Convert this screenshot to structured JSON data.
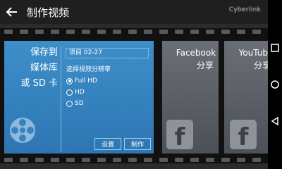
{
  "header": {
    "title": "制作视频",
    "account": "Cyberlink"
  },
  "save_card": {
    "title": "保存到\n媒体库\n或 SD 卡",
    "project_name": "项目 02-27",
    "resolution_label": "选择视频分辨率",
    "options": [
      {
        "label": "Full HD",
        "selected": true
      },
      {
        "label": "HD",
        "selected": false
      },
      {
        "label": "SD",
        "selected": false
      }
    ],
    "settings_button": "设置",
    "produce_button": "制作"
  },
  "facebook_card": {
    "title": "Facebook",
    "subtitle": "分享"
  },
  "youtube_card": {
    "title": "YouTube",
    "subtitle": "分享"
  },
  "colors": {
    "card_active": "#3a89c5",
    "card_inactive": "#5f646a",
    "header_bg": "#1f1f1f"
  }
}
